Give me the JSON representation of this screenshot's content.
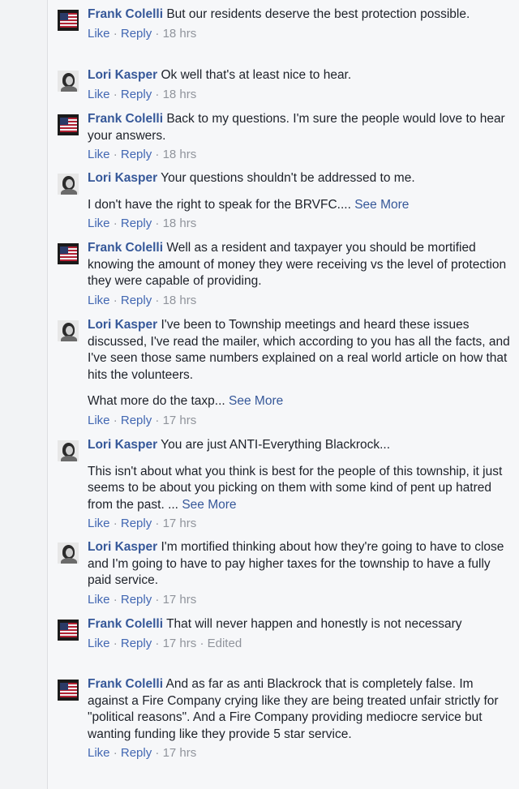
{
  "labels": {
    "like": "Like",
    "reply": "Reply",
    "separator": "·",
    "edited": "Edited"
  },
  "comments": [
    {
      "author": "Frank Colelli",
      "avatar": "flag-avatar",
      "paragraphs": [
        "But our residents deserve the best protection possible."
      ],
      "see_more": "",
      "time": "18 hrs",
      "edited": false
    },
    {
      "author": "Lori Kasper",
      "avatar": "portrait-avatar",
      "paragraphs": [
        "Ok well that's at least nice to hear."
      ],
      "see_more": "",
      "time": "18 hrs",
      "edited": false
    },
    {
      "author": "Frank Colelli",
      "avatar": "flag-avatar",
      "paragraphs": [
        "Back to my questions. I'm sure the people would love to hear your answers."
      ],
      "see_more": "",
      "time": "18 hrs",
      "edited": false
    },
    {
      "author": "Lori Kasper",
      "avatar": "portrait-avatar",
      "paragraphs": [
        "Your questions shouldn't be addressed to me.",
        "I don't have the right to speak for the BRVFC...."
      ],
      "see_more": "See More",
      "time": "18 hrs",
      "edited": false
    },
    {
      "author": "Frank Colelli",
      "avatar": "flag-avatar",
      "paragraphs": [
        "Well as a resident and taxpayer you should be mortified knowing the amount of money they were receiving vs the level of protection they were capable of providing."
      ],
      "see_more": "",
      "time": "18 hrs",
      "edited": false
    },
    {
      "author": "Lori Kasper",
      "avatar": "portrait-avatar",
      "paragraphs": [
        "I've been to Township meetings and heard these issues discussed, I've read the mailer, which according to you has all the facts, and I've seen those same numbers explained on a real world article on how that hits the volunteers.",
        "What more do the taxp..."
      ],
      "see_more": "See More",
      "time": "17 hrs",
      "edited": false
    },
    {
      "author": "Lori Kasper",
      "avatar": "portrait-avatar",
      "paragraphs": [
        "You are just ANTI-Everything Blackrock...",
        "This isn't about what you think is best for the people of this township, it just seems to be about you picking on them with some kind of pent up hatred from the past. ..."
      ],
      "see_more": "See More",
      "time": "17 hrs",
      "edited": false
    },
    {
      "author": "Lori Kasper",
      "avatar": "portrait-avatar",
      "paragraphs": [
        "I'm mortified thinking about how they're going to have to close and I'm going to have to pay higher taxes for the township to have a fully paid service."
      ],
      "see_more": "",
      "time": "17 hrs",
      "edited": false
    },
    {
      "author": "Frank Colelli",
      "avatar": "flag-avatar",
      "paragraphs": [
        "That will never happen and honestly is not necessary"
      ],
      "see_more": "",
      "time": "17 hrs",
      "edited": true
    },
    {
      "author": "Frank Colelli",
      "avatar": "flag-avatar",
      "paragraphs": [
        "And as far as anti Blackrock that is completely false. Im against a Fire Company crying like they are being treated unfair strictly for \"political reasons\". And a Fire Company providing mediocre service but wanting funding like they provide 5 star service."
      ],
      "see_more": "",
      "time": "17 hrs",
      "edited": false
    }
  ]
}
